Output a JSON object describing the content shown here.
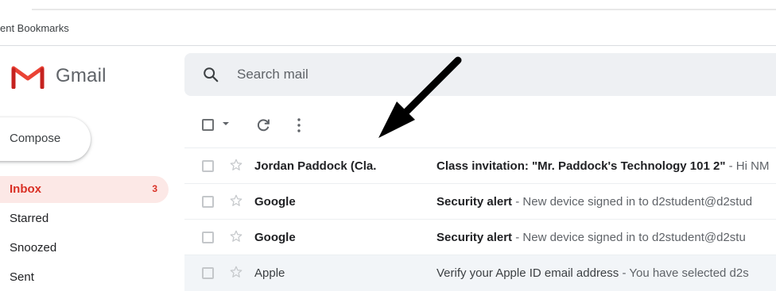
{
  "browser": {
    "bookmarks_label": "ent Bookmarks"
  },
  "app": {
    "name": "Gmail"
  },
  "search": {
    "placeholder": "Search mail"
  },
  "sidebar": {
    "compose_label": "Compose",
    "items": [
      {
        "label": "Inbox",
        "count": "3",
        "active": true
      },
      {
        "label": "Starred"
      },
      {
        "label": "Snoozed"
      },
      {
        "label": "Sent"
      }
    ]
  },
  "emails": [
    {
      "sender": "Jordan Paddock (Cla.",
      "subject": "Class invitation: \"Mr. Paddock's Technology 101 2\"",
      "separator": " - ",
      "snippet": "Hi NM",
      "unread": true
    },
    {
      "sender": "Google",
      "subject": "Security alert",
      "separator": " - ",
      "snippet": "New device signed in to d2student@d2stud",
      "unread": true
    },
    {
      "sender": "Google",
      "subject": "Security alert",
      "separator": " - ",
      "snippet": "New device signed in to d2student@d2stu",
      "unread": true
    },
    {
      "sender": "Apple",
      "subject": "Verify your Apple ID email address",
      "separator": " - ",
      "snippet": "You have selected d2s",
      "unread": false
    }
  ],
  "icons": {
    "logo": "gmail-m-logo",
    "search": "search-icon",
    "select": "checkbox-icon",
    "refresh": "refresh-icon",
    "more": "more-vert-icon",
    "star": "star-outline-icon",
    "annotation": "arrow-annotation"
  },
  "colors": {
    "accent_red": "#d93025",
    "search_bg": "#eef0f3",
    "inbox_active_bg": "#fce8e6",
    "read_row_bg": "#f2f5f8"
  }
}
